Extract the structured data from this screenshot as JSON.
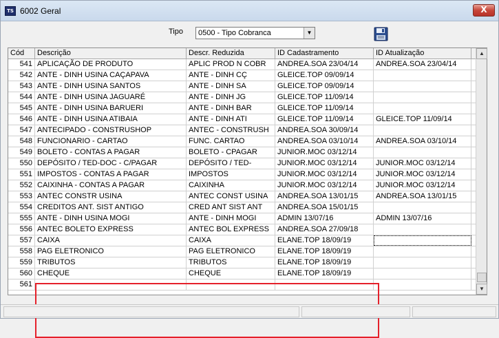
{
  "window": {
    "title": "6002 Geral",
    "icon": "app-logo-icon",
    "close_label": "X"
  },
  "filter": {
    "label": "Tipo",
    "selected": "0500 - Tipo Cobranca"
  },
  "save_icon": "floppy-save-icon",
  "table": {
    "columns": [
      "Cód",
      "Descrição",
      "Descr. Reduzida",
      "ID Cadastramento",
      "ID Atualização"
    ],
    "rows": [
      [
        "541",
        "APLICAÇÃO DE PRODUTO",
        "APLIC PROD N COBR",
        "ANDREA.SOA 23/04/14",
        "ANDREA.SOA 23/04/14"
      ],
      [
        "542",
        "ANTE - DINH USINA CAÇAPAVA",
        "ANTE - DINH CÇ",
        "GLEICE.TOP 09/09/14",
        ""
      ],
      [
        "543",
        "ANTE - DINH USINA SANTOS",
        "ANTE - DINH SA",
        "GLEICE.TOP 09/09/14",
        ""
      ],
      [
        "544",
        "ANTE - DINH USINA JAGUARÉ",
        "ANTE - DINH JG",
        "GLEICE.TOP 11/09/14",
        ""
      ],
      [
        "545",
        "ANTE - DINH USINA BARUERI",
        "ANTE - DINH BAR",
        "GLEICE.TOP 11/09/14",
        ""
      ],
      [
        "546",
        "ANTE - DINH USINA ATIBAIA",
        "ANTE - DINH ATI",
        "GLEICE.TOP 11/09/14",
        "GLEICE.TOP 11/09/14"
      ],
      [
        "547",
        "ANTECIPADO - CONSTRUSHOP",
        "ANTEC - CONSTRUSH",
        "ANDREA.SOA 30/09/14",
        ""
      ],
      [
        "548",
        "FUNCIONARIO - CARTAO",
        "FUNC. CARTAO",
        "ANDREA.SOA 03/10/14",
        "ANDREA.SOA 03/10/14"
      ],
      [
        "549",
        "BOLETO - CONTAS A PAGAR",
        "BOLETO - CPAGAR",
        "JUNIOR.MOC 03/12/14",
        ""
      ],
      [
        "550",
        "DEPÓSITO / TED-DOC - C/PAGAR",
        "DEPÓSITO / TED-",
        "JUNIOR.MOC 03/12/14",
        "JUNIOR.MOC 03/12/14"
      ],
      [
        "551",
        "IMPOSTOS - CONTAS A PAGAR",
        "IMPOSTOS",
        "JUNIOR.MOC 03/12/14",
        "JUNIOR.MOC 03/12/14"
      ],
      [
        "552",
        "CAIXINHA - CONTAS A PAGAR",
        "CAIXINHA",
        "JUNIOR.MOC 03/12/14",
        "JUNIOR.MOC 03/12/14"
      ],
      [
        "553",
        "ANTEC CONSTR USINA",
        "ANTEC CONST USINA",
        "ANDREA.SOA 13/01/15",
        "ANDREA.SOA 13/01/15"
      ],
      [
        "554",
        "CREDITOS ANT. SIST ANTIGO",
        "CRED ANT SIST ANT",
        "ANDREA.SOA 15/01/15",
        ""
      ],
      [
        "555",
        "ANTE - DINH USINA MOGI",
        "ANTE - DINH MOGI",
        "ADMIN 13/07/16",
        "ADMIN 13/07/16"
      ],
      [
        "556",
        "ANTEC BOLETO EXPRESS",
        "ANTEC BOL EXPRESS",
        "ANDREA.SOA 27/09/18",
        ""
      ],
      [
        "557",
        "CAIXA",
        "CAIXA",
        "ELANE.TOP 18/09/19",
        ""
      ],
      [
        "558",
        "PAG ELETRONICO",
        "PAG ELETRONICO",
        "ELANE.TOP 18/09/19",
        ""
      ],
      [
        "559",
        "TRIBUTOS",
        "TRIBUTOS",
        "ELANE.TOP 18/09/19",
        ""
      ],
      [
        "560",
        "CHEQUE",
        "CHEQUE",
        "ELANE.TOP 18/09/19",
        ""
      ],
      [
        "561",
        "",
        "",
        "",
        ""
      ]
    ]
  }
}
